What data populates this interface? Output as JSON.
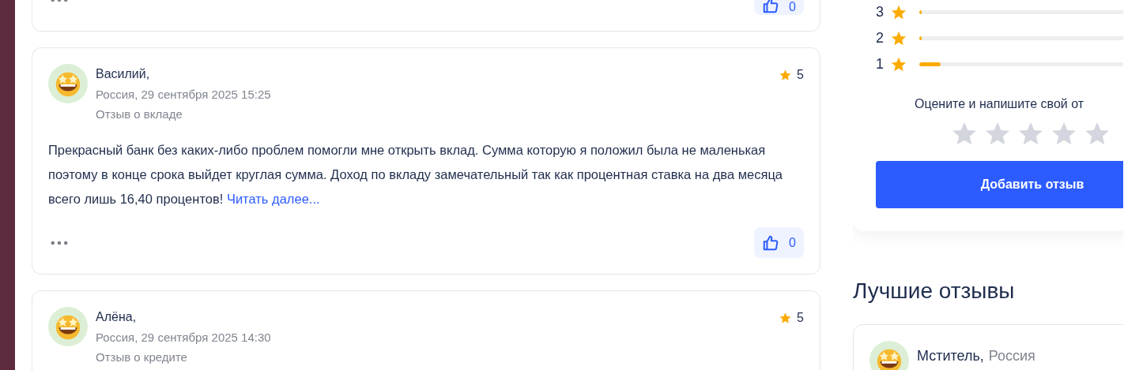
{
  "reviews": [
    {
      "likes": "0"
    },
    {
      "author": "Василий,",
      "meta": "Россия, 29 сентября 2025 15:25",
      "topic": "Отзыв о вкладе",
      "rating": "5",
      "text": "Прекрасный банк без каких-либо проблем помогли мне открыть вклад. Сумма которую я положил была не маленькая поэтому в конце срока выйдет круглая сумма. Доход по вкладу замечательный так как процентная ставка на два месяца всего лишь 16,40 процентов!",
      "read_more": "Читать далее...",
      "likes": "0"
    },
    {
      "author": "Алёна,",
      "meta": "Россия, 29 сентября 2025 14:30",
      "topic": "Отзыв о кредите",
      "rating": "5"
    }
  ],
  "rating_summary": {
    "bars": [
      {
        "label": "3",
        "level": 0.01
      },
      {
        "label": "2",
        "level": 0.01
      },
      {
        "label": "1",
        "level": 0.1
      }
    ],
    "prompt": "Оцените и напишите свой от",
    "stars": 0,
    "button": "Добавить отзыв"
  },
  "best_reviews": {
    "title": "Лучшие отзывы",
    "items": [
      {
        "author": "Мститель,",
        "location": "Россия"
      }
    ]
  }
}
